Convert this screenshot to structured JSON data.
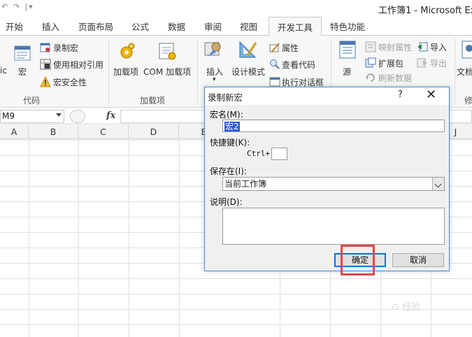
{
  "window": {
    "title": "工作簿1 - Microsoft Ex",
    "qat_undo": "↶",
    "qat_redo": "↷",
    "qat_menu": "|▾"
  },
  "tabs": [
    {
      "label": "开始"
    },
    {
      "label": "插入"
    },
    {
      "label": "页面布局"
    },
    {
      "label": "公式"
    },
    {
      "label": "数据"
    },
    {
      "label": "审阅"
    },
    {
      "label": "视图"
    },
    {
      "label": "开发工具",
      "active": true
    },
    {
      "label": "特色功能"
    }
  ],
  "ribbon": {
    "code": {
      "vba_partial": "ic",
      "macros": "宏",
      "record_macro": "录制宏",
      "use_relative": "使用相对引用",
      "macro_security": "宏安全性",
      "group_label": "代码"
    },
    "addins": {
      "addins": "加载项",
      "com_addins": "COM 加载项",
      "group_label": "加载项"
    },
    "controls": {
      "insert": "插入",
      "design_mode": "设计模式",
      "properties": "属性",
      "view_code": "查看代码",
      "run_dialog": "执行对话框"
    },
    "xml": {
      "source": "源",
      "map_properties": "映射属性",
      "expansion_packs": "扩展包",
      "refresh_data": "刷新数据",
      "import": "导入",
      "export": "导出"
    },
    "modify": {
      "document_panel_partial": "文档",
      "group_partial": "修"
    }
  },
  "formula_bar": {
    "name_box": "M9",
    "fx": "fx"
  },
  "columns": [
    "A",
    "B",
    "C",
    "D",
    "E",
    "J"
  ],
  "dialog": {
    "title": "录制新宏",
    "help": "?",
    "close": "✕",
    "macro_name_label": "宏名(M):",
    "macro_name_value": "宏2",
    "shortcut_label": "快捷键(K):",
    "shortcut_prefix": "Ctrl+",
    "shortcut_value": "",
    "store_in_label": "保存在(I):",
    "store_in_value": "当前工作簿",
    "description_label": "说明(D):",
    "description_value": "",
    "ok": "确定",
    "cancel": "取消"
  },
  "watermark": "⊙ 经验"
}
